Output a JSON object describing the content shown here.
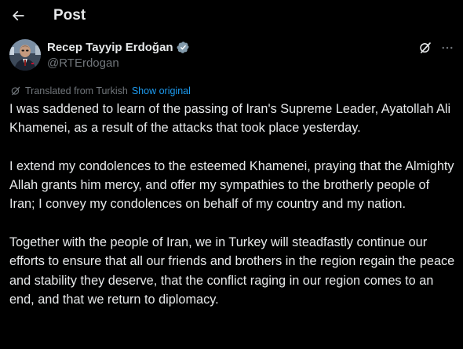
{
  "header": {
    "title": "Post"
  },
  "author": {
    "display_name": "Recep Tayyip Erdoğan",
    "handle": "@RTErdogan",
    "verified": true
  },
  "translation": {
    "label": "Translated from Turkish",
    "show_original": "Show original"
  },
  "post": {
    "paragraphs": [
      "I was saddened to learn of the passing of Iran's Supreme Leader, Ayatollah Ali Khamenei, as a result of the attacks that took place yesterday.",
      "I extend my condolences to the esteemed Khamenei, praying that the Almighty Allah grants him mercy, and offer my sympathies to the brotherly people of Iran; I convey my condolences on behalf of my country and my nation.",
      "Together with the people of Iran, we in Turkey will steadfastly continue our efforts to ensure that all our friends and brothers in the region regain the peace and stability they deserve, that the conflict raging in our region comes to an end, and that we return to diplomacy."
    ]
  },
  "colors": {
    "background": "#000000",
    "text": "#e7e9ea",
    "secondary": "#71767b",
    "accent": "#1d9bf0"
  },
  "icons": {
    "back": "arrow-left-icon",
    "verified": "verified-badge-icon",
    "grok": "grok-icon",
    "more": "more-icon",
    "translate": "translate-icon"
  }
}
